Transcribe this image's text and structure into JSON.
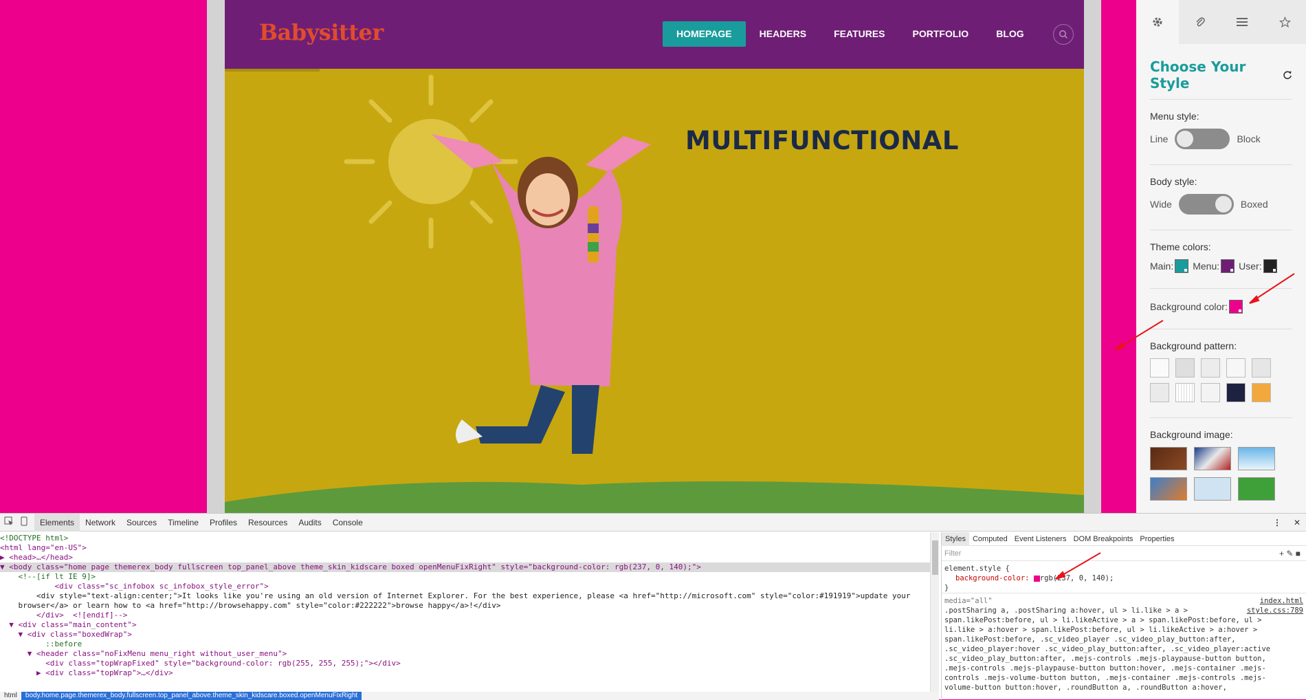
{
  "site": {
    "logo": "Babysitter",
    "nav": [
      "HOMEPAGE",
      "HEADERS",
      "FEATURES",
      "PORTFOLIO",
      "BLOG"
    ],
    "active_nav": "HOMEPAGE",
    "hero_title": "MULTIFUNCTIONAL",
    "colors": {
      "header": "#6e1f75",
      "hero": "#c7a710",
      "accent": "#1a9c9c",
      "logo": "#e04c2c",
      "page_bg": "#ed008c"
    }
  },
  "panel": {
    "tab_icons": [
      "gear-icon",
      "paperclip-icon",
      "menu-icon",
      "star-icon"
    ],
    "title": "Choose Your Style",
    "menu_style": {
      "label": "Menu style:",
      "left": "Line",
      "right": "Block"
    },
    "body_style": {
      "label": "Body style:",
      "left": "Wide",
      "right": "Boxed"
    },
    "theme_colors": {
      "label": "Theme colors:",
      "main": "Main:",
      "menu": "Menu:",
      "user": "User:",
      "main_color": "#1a9c9c",
      "menu_color": "#6e1f75",
      "user_color": "#222222"
    },
    "background_color": {
      "label": "Background color:",
      "color": "#ed008c"
    },
    "background_pattern": {
      "label": "Background pattern:"
    },
    "background_image": {
      "label": "Background image:"
    }
  },
  "devtools": {
    "tabs": [
      "Elements",
      "Network",
      "Sources",
      "Timeline",
      "Profiles",
      "Resources",
      "Audits",
      "Console"
    ],
    "active_tab": "Elements",
    "style_tabs": [
      "Styles",
      "Computed",
      "Event Listeners",
      "DOM Breakpoints",
      "Properties"
    ],
    "filter_placeholder": "Filter",
    "element_style_selector": "element.style {",
    "element_style_prop": "background-color:",
    "element_style_value": "rgb(237, 0, 140);",
    "element_style_close": "}",
    "media_rule": "media=\"all\"",
    "source_file": "index.html",
    "source_css": "style.css:789",
    "css_selectors": [
      ".postSharing a, .postSharing a:hover, ul > li.like > a >",
      "span.likePost:before, ul > li.likeActive > a > span.likePost:before, ul >",
      "li.like > a:hover > span.likePost:before, ul > li.likeActive > a:hover >",
      "span.likePost:before, .sc_video_player .sc_video_play_button:after,",
      ".sc_video_player:hover .sc_video_play_button:after, .sc_video_player:active",
      ".sc_video_play_button:after, .mejs-controls .mejs-playpause-button button,",
      ".mejs-controls .mejs-playpause-button button:hover, .mejs-container .mejs-",
      "controls .mejs-volume-button button, .mejs-container .mejs-controls .mejs-",
      "volume-button button:hover, .roundButton a, .roundButton a:hover,"
    ],
    "dom_lines": [
      "<!DOCTYPE html>",
      "<html lang=\"en-US\">",
      "▶ <head>…</head>",
      "▼ <body class=\"home page themerex_body fullscreen top_panel_above theme_skin_kidscare boxed openMenuFixRight\" style=\"background-color: rgb(237, 0, 140);\">",
      "    <!--[if lt IE 9]>",
      "            <div class=\"sc_infobox sc_infobox_style_error\">",
      "        <div style=\"text-align:center;\">It looks like you're using an old version of Internet Explorer. For the best experience, please <a href=\"http://microsoft.com\" style=\"color:#191919\">update your",
      "    browser</a> or learn how to <a href=\"http://browsehappy.com\" style=\"color:#222222\">browse happy</a>!</div>",
      "        </div>  <![endif]-->",
      "  ▼ <div class=\"main_content\">",
      "    ▼ <div class=\"boxedWrap\">",
      "          ::before",
      "      ▼ <header class=\"noFixMenu menu_right without_user_menu\">",
      "          <div class=\"topWrapFixed\" style=\"background-color: rgb(255, 255, 255);\"></div>",
      "        ▶ <div class=\"topWrap\">…</div>"
    ],
    "breadcrumbs": [
      "html",
      "body.home.page.themerex_body.fullscreen.top_panel_above.theme_skin_kidscare.boxed.openMenuFixRight"
    ]
  }
}
